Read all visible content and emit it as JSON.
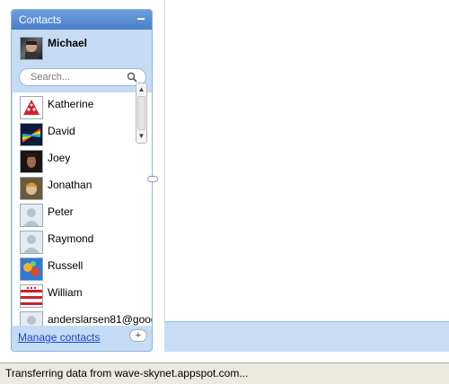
{
  "contacts_panel": {
    "title": "Contacts",
    "current_user": "Michael",
    "search_placeholder": "Search...",
    "items": [
      {
        "name": "Katherine",
        "avatar": "red-ladybug-avatar"
      },
      {
        "name": "David",
        "avatar": "rainbow-prism-avatar"
      },
      {
        "name": "Joey",
        "avatar": "photo-avatar"
      },
      {
        "name": "Jonathan",
        "avatar": "photo-avatar"
      },
      {
        "name": "Peter",
        "avatar": "default-person-avatar"
      },
      {
        "name": "Raymond",
        "avatar": "default-person-avatar"
      },
      {
        "name": "Russell",
        "avatar": "colorful-artwork-avatar"
      },
      {
        "name": "William",
        "avatar": "stripes-avatar"
      },
      {
        "name": "anderslarsen81@goog",
        "avatar": "default-person-avatar"
      }
    ],
    "manage_label": "Manage contacts",
    "add_label": "+"
  },
  "status_bar": {
    "text": "Transferring data from wave-skynet.appspot.com..."
  },
  "colors": {
    "panel_bg": "#c6dcf4",
    "header_bg": "#4a7fcb",
    "link": "#1d46c4",
    "status_bg": "#ece9e0"
  }
}
